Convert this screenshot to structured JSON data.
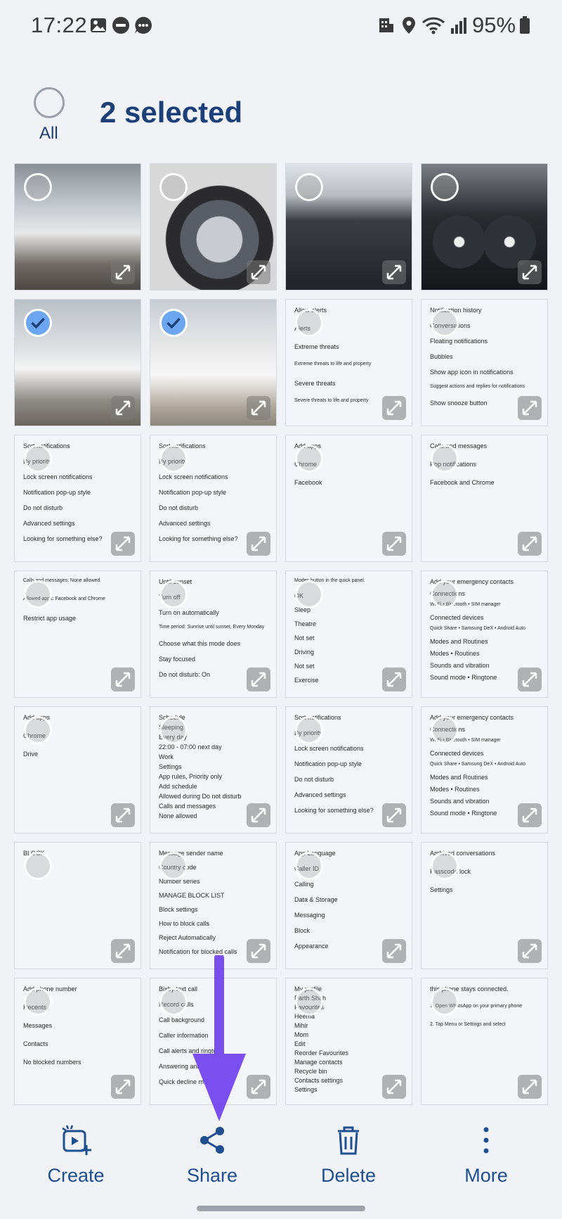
{
  "status_bar": {
    "time": "17:22",
    "battery": "95%"
  },
  "header": {
    "select_all_label": "All",
    "title": "2 selected"
  },
  "tiles": [
    {
      "kind": "photo",
      "selected": false
    },
    {
      "kind": "photo",
      "selected": false
    },
    {
      "kind": "photo",
      "selected": false
    },
    {
      "kind": "photo",
      "selected": false
    },
    {
      "kind": "photo",
      "selected": true
    },
    {
      "kind": "photo",
      "selected": true
    },
    {
      "kind": "screenshot",
      "selected": false,
      "lines": [
        "Allow alerts",
        "Alerts",
        "Extreme threats",
        "Extreme threats to life and property",
        "Severe threats",
        "Severe threats to life and property"
      ]
    },
    {
      "kind": "screenshot",
      "selected": false,
      "lines": [
        "Notification history",
        "Conversations",
        "Floating notifications",
        "Bubbles",
        "Show app icon in notifications",
        "Suggest actions and replies for notifications",
        "Show snooze button"
      ]
    },
    {
      "kind": "screenshot",
      "selected": false,
      "lines": [
        "Sort notifications",
        "By priority",
        "Lock screen notifications",
        "Notification pop-up style",
        "Do not disturb",
        "Advanced settings",
        "Looking for something else?"
      ]
    },
    {
      "kind": "screenshot",
      "selected": false,
      "lines": [
        "Sort notifications",
        "By priority",
        "Lock screen notifications",
        "Notification pop-up style",
        "Do not disturb",
        "Advanced settings",
        "Looking for something else?"
      ]
    },
    {
      "kind": "screenshot",
      "selected": false,
      "lines": [
        "Add apps",
        "Chrome",
        "Facebook"
      ]
    },
    {
      "kind": "screenshot",
      "selected": false,
      "lines": [
        "Calls and messages",
        "Pop notifications",
        "Facebook and Chrome"
      ]
    },
    {
      "kind": "screenshot",
      "selected": false,
      "lines": [
        "Calls and messages: None allowed",
        "Allowed apps: Facebook and Chrome",
        "Restrict app usage"
      ]
    },
    {
      "kind": "screenshot",
      "selected": false,
      "lines": [
        "Until sunset",
        "Turn off",
        "Turn on automatically",
        "Time period: Sunrise until sunset, Every Monday",
        "Choose what this mode does",
        "Stay focused",
        "Do not disturb: On"
      ]
    },
    {
      "kind": "screenshot",
      "selected": false,
      "lines": [
        "Modes button in the quick panel.",
        "OK",
        "Sleep",
        "Theatre",
        "Not set",
        "Driving",
        "Not set",
        "Exercise"
      ]
    },
    {
      "kind": "screenshot",
      "selected": false,
      "lines": [
        "Add your emergency contacts",
        "Connections",
        "Wi-Fi • Bluetooth • SIM manager",
        "Connected devices",
        "Quick Share • Samsung DeX • Android Auto",
        "Modes and Routines",
        "Modes • Routines",
        "Sounds and vibration",
        "Sound mode • Ringtone"
      ]
    },
    {
      "kind": "screenshot",
      "selected": false,
      "lines": [
        "Add apps",
        "Chrome",
        "Drive"
      ]
    },
    {
      "kind": "screenshot",
      "selected": false,
      "lines": [
        "Schedule",
        "Sleeping",
        "Every day",
        "22:00 - 07:00 next day",
        "Work",
        "Settings",
        "App rules, Priority only",
        "Add schedule",
        "Allowed during Do not disturb",
        "Calls and messages",
        "None allowed"
      ]
    },
    {
      "kind": "screenshot",
      "selected": false,
      "lines": [
        "Sort notifications",
        "By priority",
        "Lock screen notifications",
        "Notification pop-up style",
        "Do not disturb",
        "Advanced settings",
        "Looking for something else?"
      ]
    },
    {
      "kind": "screenshot",
      "selected": false,
      "lines": [
        "Add your emergency contacts",
        "Connections",
        "Wi-Fi • Bluetooth • SIM manager",
        "Connected devices",
        "Quick Share • Samsung DeX • Android Auto",
        "Modes and Routines",
        "Modes • Routines",
        "Sounds and vibration",
        "Sound mode • Ringtone"
      ]
    },
    {
      "kind": "screenshot",
      "selected": false,
      "lines": [
        "BLOCK"
      ]
    },
    {
      "kind": "screenshot",
      "selected": false,
      "lines": [
        "Message sender name",
        "Country code",
        "Number series",
        "MANAGE BLOCK LIST",
        "Block settings",
        "How to block calls",
        "Reject Automatically",
        "Notification for blocked calls"
      ]
    },
    {
      "kind": "screenshot",
      "selected": false,
      "lines": [
        "App Language",
        "Caller ID",
        "Calling",
        "Data & Storage",
        "Messaging",
        "Block",
        "Appearance"
      ]
    },
    {
      "kind": "screenshot",
      "selected": false,
      "lines": [
        "Archived conversations",
        "Passcode lock",
        "Settings"
      ]
    },
    {
      "kind": "screenshot",
      "selected": false,
      "lines": [
        "Add phone number",
        "Recents",
        "Messages",
        "Contacts",
        "No blocked numbers"
      ]
    },
    {
      "kind": "screenshot",
      "selected": false,
      "lines": [
        "Bixby text call",
        "Record calls",
        "Call background",
        "Caller information",
        "Call alerts and ringtone",
        "Answering and ending calls",
        "Quick decline messages"
      ]
    },
    {
      "kind": "screenshot",
      "selected": false,
      "lines": [
        "My profile",
        "Parth Shah",
        "Favourites",
        "Heema",
        "Mihir",
        "Mom",
        "Edit",
        "Reorder Favourites",
        "Manage contacts",
        "Recycle bin",
        "Contacts settings",
        "Settings"
      ]
    },
    {
      "kind": "screenshot",
      "selected": false,
      "lines": [
        "this phone stays connected.",
        "1. Open WhatsApp on your primary phone",
        "2. Tap Menu or Settings and select"
      ]
    }
  ],
  "actions": {
    "create": "Create",
    "share": "Share",
    "delete": "Delete",
    "more": "More"
  },
  "colors": {
    "accent": "#1b3f79",
    "label": "#1d4f91",
    "arrow": "#7b4ef0",
    "check": "#6ca6f0"
  },
  "icons": {
    "create": "create-clip-icon",
    "share": "share-icon",
    "delete": "trash-icon",
    "more": "more-vertical-icon"
  }
}
